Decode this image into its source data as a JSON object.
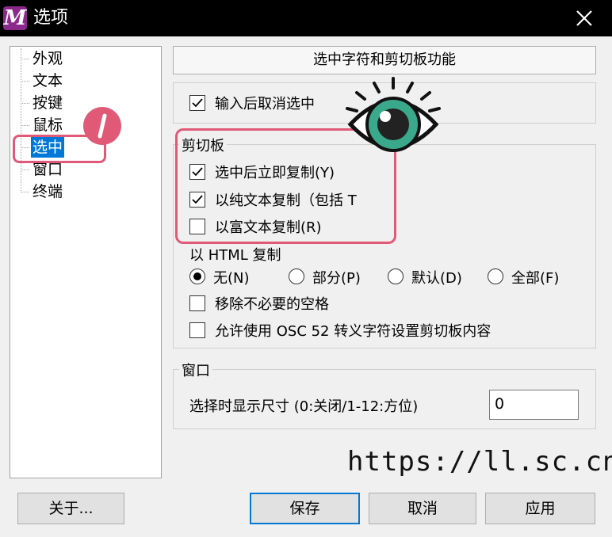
{
  "window": {
    "title": "选项",
    "app_icon_letter": "M"
  },
  "tree": {
    "items": [
      {
        "label": "外观",
        "selected": false
      },
      {
        "label": "文本",
        "selected": false
      },
      {
        "label": "按键",
        "selected": false
      },
      {
        "label": "鼠标",
        "selected": false
      },
      {
        "label": "选中",
        "selected": true
      },
      {
        "label": "窗口",
        "selected": false
      },
      {
        "label": "终端",
        "selected": false
      }
    ]
  },
  "section_header": "选中字符和剪切板功能",
  "deselect_after_input": {
    "label": "输入后取消选中",
    "checked": true
  },
  "clipboard": {
    "group_label": "剪切板",
    "copy_on_select": {
      "label": "选中后立即复制(Y)",
      "checked": true
    },
    "copy_plain_text": {
      "label": "以纯文本复制（包括 T",
      "checked": true
    },
    "copy_rich_text": {
      "label": "以富文本复制(R)",
      "checked": false
    }
  },
  "html_copy": {
    "label": "以 HTML 复制",
    "options": [
      {
        "label": "无(N)",
        "selected": true
      },
      {
        "label": "部分(P)",
        "selected": false
      },
      {
        "label": "默认(D)",
        "selected": false
      },
      {
        "label": "全部(F)",
        "selected": false
      }
    ]
  },
  "remove_spaces": {
    "label": "移除不必要的空格",
    "checked": false
  },
  "allow_osc52": {
    "label": "允许使用 OSC 52 转义字符设置剪切板内容",
    "checked": false
  },
  "window_group": {
    "label": "窗口",
    "size_label": "选择时显示尺寸 (0:关闭/1-12:方位)",
    "size_value": "0"
  },
  "buttons": {
    "about": "关于...",
    "save": "保存",
    "cancel": "取消",
    "apply": "应用"
  },
  "annotation": {
    "badge_text": "/",
    "watermark": "https://ll.sc.cn",
    "accent_color": "#e05a78",
    "eye_color": "#3aa88a"
  }
}
